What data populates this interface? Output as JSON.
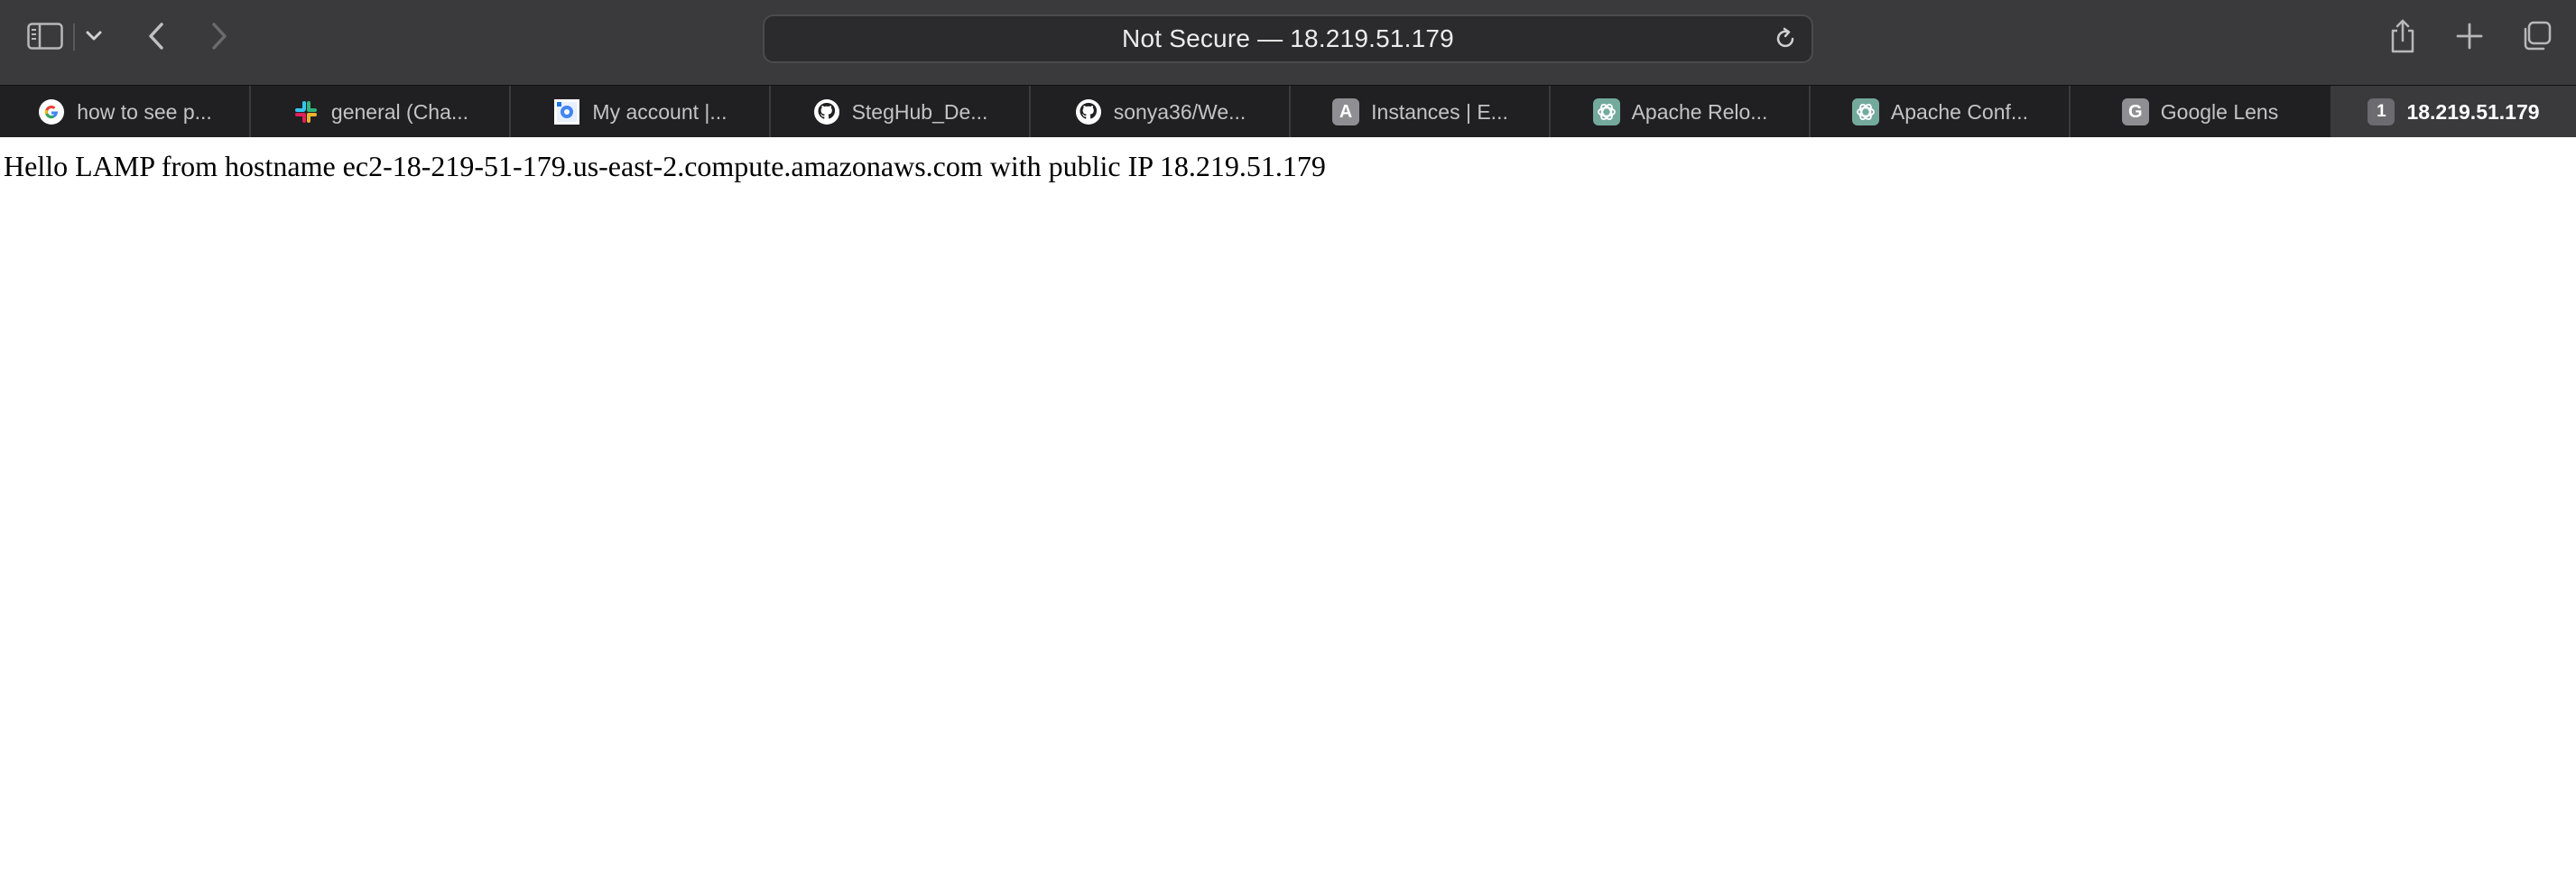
{
  "browser": {
    "address_bar": {
      "text": "Not Secure — 18.219.51.179"
    },
    "toolbar_icons": [
      "sidebar-icon",
      "chevron-down-icon",
      "back-arrow-icon",
      "forward-arrow-icon",
      "reload-icon",
      "share-icon",
      "plus-icon",
      "tab-overview-icon"
    ],
    "colors": {
      "toolbar": "#3a3a3c",
      "tab_strip": "#202022",
      "active_tab": "#3a3a3c"
    }
  },
  "tabs": [
    {
      "label": "how to see p...",
      "favicon": "google-icon"
    },
    {
      "label": "general (Cha...",
      "favicon": "slack-icon"
    },
    {
      "label": "My account |...",
      "favicon": "account-icon"
    },
    {
      "label": "StegHub_De...",
      "favicon": "github-icon"
    },
    {
      "label": "sonya36/We...",
      "favicon": "github-icon"
    },
    {
      "label": "Instances | E...",
      "favicon": "letter-icon",
      "favicon_letter": "A"
    },
    {
      "label": "Apache Relo...",
      "favicon": "openai-icon"
    },
    {
      "label": "Apache Conf...",
      "favicon": "openai-icon"
    },
    {
      "label": "Google Lens",
      "favicon": "letter-icon",
      "favicon_letter": "G"
    },
    {
      "label": "18.219.51.179",
      "favicon": "letter-icon",
      "favicon_letter": "1",
      "active": true
    }
  ],
  "page": {
    "message": "Hello LAMP from hostname ec2-18-219-51-179.us-east-2.compute.amazonaws.com with public IP 18.219.51.179"
  }
}
